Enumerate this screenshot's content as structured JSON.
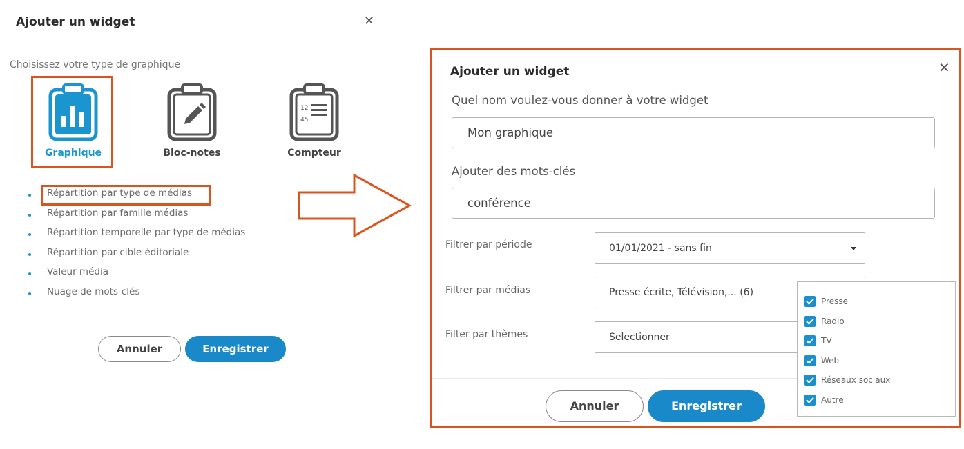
{
  "left_dialog": {
    "title": "Ajouter un widget",
    "close_glyph": "✕",
    "subtitle": "Choisissez votre type de graphique",
    "chart_types": [
      {
        "label": "Graphique",
        "icon": "bar-chart-clipboard-icon",
        "selected": true
      },
      {
        "label": "Bloc-notes",
        "icon": "notepad-pencil-icon",
        "selected": false
      },
      {
        "label": "Compteur",
        "icon": "counter-list-icon",
        "selected": false
      }
    ],
    "chart_options": [
      "Répartition par type de médias",
      "Répartition par famille médias",
      "Répartition temporelle par type de médias",
      "Répartition par cible éditoriale",
      "Valeur média",
      "Nuage de mots-clés"
    ],
    "highlighted_option": "Répartition par type de médias",
    "cancel_label": "Annuler",
    "save_label": "Enregistrer"
  },
  "right_dialog": {
    "title": "Ajouter un widget",
    "close_glyph": "✕",
    "name_label": "Quel nom voulez-vous donner à votre widget",
    "name_value": "Mon graphique",
    "keywords_label": "Ajouter des mots-clés",
    "keywords_value": "conférence",
    "period_label": "Filtrer par période",
    "period_value": "01/01/2021 - sans fin",
    "media_label": "Filtrer par médias",
    "media_value": "Presse écrite, Télévision,... (6)",
    "themes_label": "Filter par thèmes",
    "themes_value": "Selectionner",
    "media_options": [
      {
        "label": "Presse",
        "checked": true
      },
      {
        "label": "Radio",
        "checked": true
      },
      {
        "label": "TV",
        "checked": true
      },
      {
        "label": "Web",
        "checked": true
      },
      {
        "label": "Réseaux sociaux",
        "checked": true
      },
      {
        "label": "Autre",
        "checked": true
      }
    ],
    "cancel_label": "Annuler",
    "save_label": "Enregistrer"
  },
  "colors": {
    "accent": "#1989c9",
    "highlight": "#d9541f",
    "icon_blue": "#1a95d0",
    "icon_gray": "#555555"
  }
}
